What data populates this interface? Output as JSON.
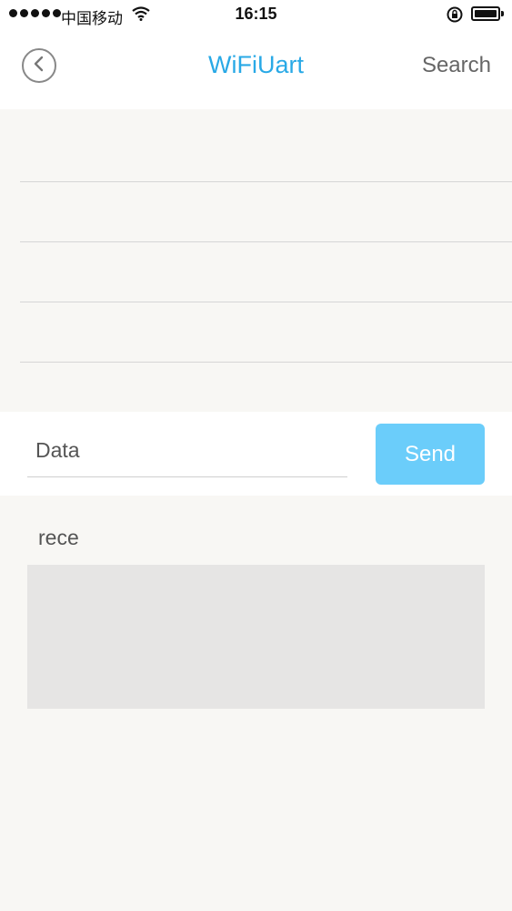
{
  "status_bar": {
    "carrier": "中国移动",
    "time": "16:15",
    "icons": [
      "signal-dots",
      "wifi-icon",
      "rotation-lock-icon",
      "battery-icon"
    ]
  },
  "nav": {
    "back_icon": "chevron-left-icon",
    "title": "WiFiUart",
    "search_label": "Search"
  },
  "device_list": {
    "rows": [
      "",
      "",
      "",
      ""
    ]
  },
  "send_panel": {
    "input_placeholder": "Data",
    "input_value": "",
    "send_label": "Send"
  },
  "receive": {
    "label": "rece",
    "content": ""
  },
  "colors": {
    "accent": "#29a9e6",
    "send_button": "#6bcdfa",
    "background": "#f8f7f4",
    "receive_box": "#e6e5e4"
  }
}
